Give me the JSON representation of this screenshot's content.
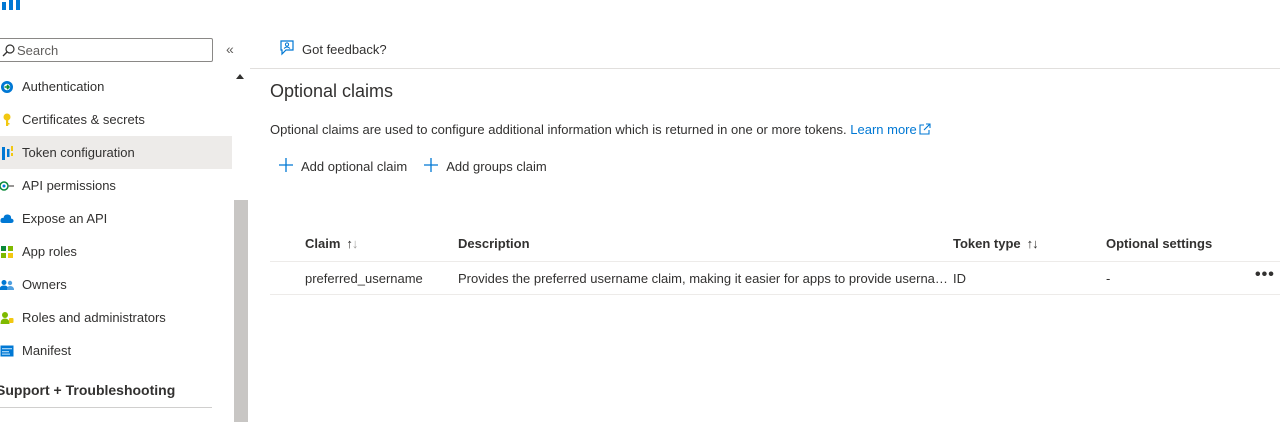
{
  "sidebar": {
    "search_placeholder": "Search",
    "collapse_glyph": "«",
    "items": [
      {
        "label": "Authentication",
        "icon": "authentication-icon"
      },
      {
        "label": "Certificates & secrets",
        "icon": "key-icon"
      },
      {
        "label": "Token configuration",
        "icon": "token-config-icon",
        "active": true
      },
      {
        "label": "API permissions",
        "icon": "api-permissions-icon"
      },
      {
        "label": "Expose an API",
        "icon": "cloud-icon"
      },
      {
        "label": "App roles",
        "icon": "app-roles-icon"
      },
      {
        "label": "Owners",
        "icon": "owners-icon"
      },
      {
        "label": "Roles and administrators",
        "icon": "roles-admin-icon"
      },
      {
        "label": "Manifest",
        "icon": "manifest-icon"
      }
    ],
    "section_title": "Support + Troubleshooting"
  },
  "cmdbar": {
    "feedback_label": "Got feedback?"
  },
  "main": {
    "section_title": "Optional claims",
    "description": "Optional claims are used to configure additional information which is returned in one or more tokens. ",
    "learn_more": "Learn more",
    "actions": {
      "add_optional_claim": "Add optional claim",
      "add_groups_claim": "Add groups claim"
    }
  },
  "table": {
    "headers": {
      "claim": "Claim",
      "description": "Description",
      "token_type": "Token type",
      "optional_settings": "Optional settings"
    },
    "rows": [
      {
        "claim": "preferred_username",
        "description": "Provides the preferred username claim, making it easier for apps to provide username hints and show human readable display names, even if their tokens are used across tenants.",
        "token_type": "ID",
        "optional_settings": "-"
      }
    ],
    "row_more": "•••"
  },
  "colors": {
    "accent": "#0078d4",
    "active_bg": "#edebe9",
    "text": "#323130"
  }
}
